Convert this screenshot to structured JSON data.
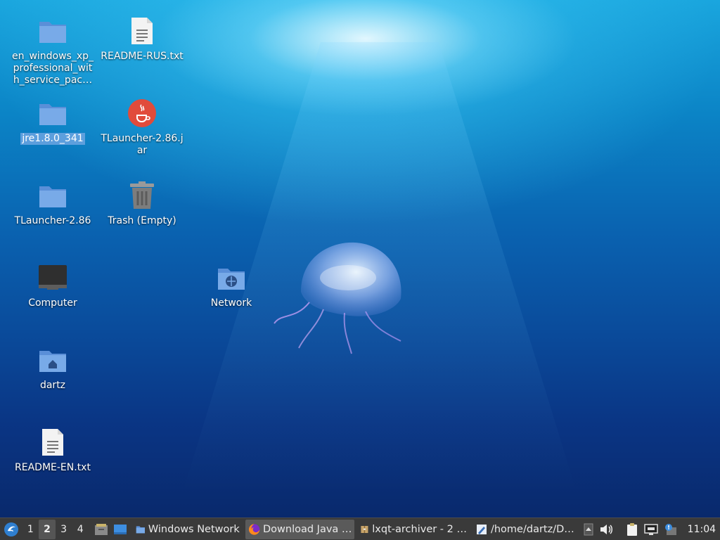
{
  "desktop": {
    "icons": [
      {
        "label": "en_windows_xp_professional_with_service_pac…",
        "icon": "folder-icon"
      },
      {
        "label": "README-RUS.txt",
        "icon": "text-file-icon"
      },
      {
        "label": "jre1.8.0_341",
        "icon": "folder-icon"
      },
      {
        "label": "TLauncher-2.86.jar",
        "icon": "java-icon"
      },
      {
        "label": "TLauncher-2.86",
        "icon": "folder-icon"
      },
      {
        "label": "Trash (Empty)",
        "icon": "trash-icon"
      },
      {
        "label": "Computer",
        "icon": "computer-icon"
      },
      {
        "label": "Network",
        "icon": "network-folder-icon"
      },
      {
        "label": "dartz",
        "icon": "home-folder-icon"
      },
      {
        "label": "README-EN.txt",
        "icon": "text-file-icon"
      }
    ]
  },
  "taskbar": {
    "desktops": [
      "1",
      "2",
      "3",
      "4"
    ],
    "active_desktop": "2",
    "tasks": [
      {
        "label": "Windows Network",
        "icon": "folder-icon"
      },
      {
        "label": "Download Java …",
        "icon": "firefox-icon"
      },
      {
        "label": "lxqt-archiver - 2 …",
        "icon": "archive-icon"
      },
      {
        "label": "/home/dartz/D…",
        "icon": "text-editor-icon"
      }
    ],
    "clock": "11:04"
  },
  "colors": {
    "taskbar_bg": "#3a3a3a",
    "selection": "#78aae6"
  }
}
